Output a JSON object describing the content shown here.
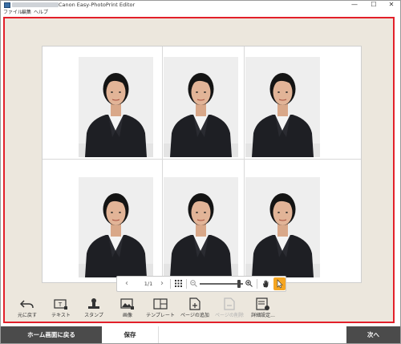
{
  "window": {
    "title": "Canon Easy-PhotoPrint Editor",
    "controls": {
      "minimize": "—",
      "maximize": "☐",
      "close": "✕"
    }
  },
  "menu": {
    "items": [
      "ファイル",
      "編集",
      "ヘルプ"
    ]
  },
  "canvas": {
    "photo_count": 6,
    "accent_color": "#e2202a"
  },
  "navigation": {
    "prev": "‹",
    "page_number": "1/1",
    "next": "›",
    "zoom_out": "－",
    "zoom_in": "＋",
    "zoom_level": 0.9
  },
  "toolbar": {
    "items": [
      {
        "label": "元に戻す",
        "icon": "undo-icon",
        "enabled": true
      },
      {
        "label": "テキスト",
        "icon": "text-box-icon",
        "enabled": true
      },
      {
        "label": "スタンプ",
        "icon": "stamp-icon",
        "enabled": true
      },
      {
        "label": "画像",
        "icon": "image-add-icon",
        "enabled": true
      },
      {
        "label": "テンプレート",
        "icon": "template-icon",
        "enabled": true
      },
      {
        "label": "ページの追加",
        "icon": "page-add-icon",
        "enabled": true
      },
      {
        "label": "ページの削除",
        "icon": "page-delete-icon",
        "enabled": false
      },
      {
        "label": "詳細設定...",
        "icon": "settings-list-icon",
        "enabled": true
      }
    ]
  },
  "footer": {
    "home_label": "ホーム画面に戻る",
    "save_label": "保存",
    "next_label": "次へ"
  }
}
